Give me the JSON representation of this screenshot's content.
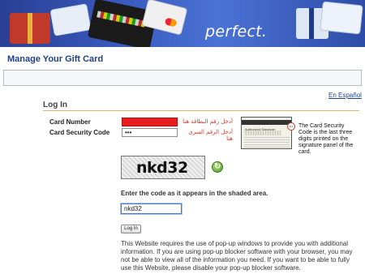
{
  "banner": {
    "tagline": "perfect."
  },
  "page": {
    "title": "Manage Your Gift Card",
    "language_link": "En Español"
  },
  "login": {
    "section_title": "Log In",
    "card_number_label": "Card Number",
    "card_number_hint_ar": "أدخل رقم البطاقة هنا",
    "security_code_label": "Card Security Code",
    "security_code_value": "•••",
    "security_code_hint_ar": "أدخل الرقم السري هنا",
    "security_code_help": "The Card Security Code is the last three digits printed on the signature panel of the card.",
    "signature_panel_label": "Authorized Signature",
    "captcha_text": "nkd32",
    "captcha_instruction": "Enter the code as it appears in the shaded area.",
    "captcha_input_value": "nkd32",
    "login_button": "Log In",
    "popup_note": "This Website requires the use of pop-up windows to provide you with additional information. If you are using pop-up blocker software with your browser, you may not be able to view all of the information you need. If you want to be able to fully use this Website, please disable your pop-up blocker software."
  },
  "colors": {
    "title_blue": "#1f3f86",
    "rule_gold": "#e0b56b",
    "error_red": "#e81d1d",
    "arabic_hint_red": "#d33b2c"
  },
  "icons": {
    "refresh": "refresh-icon"
  }
}
